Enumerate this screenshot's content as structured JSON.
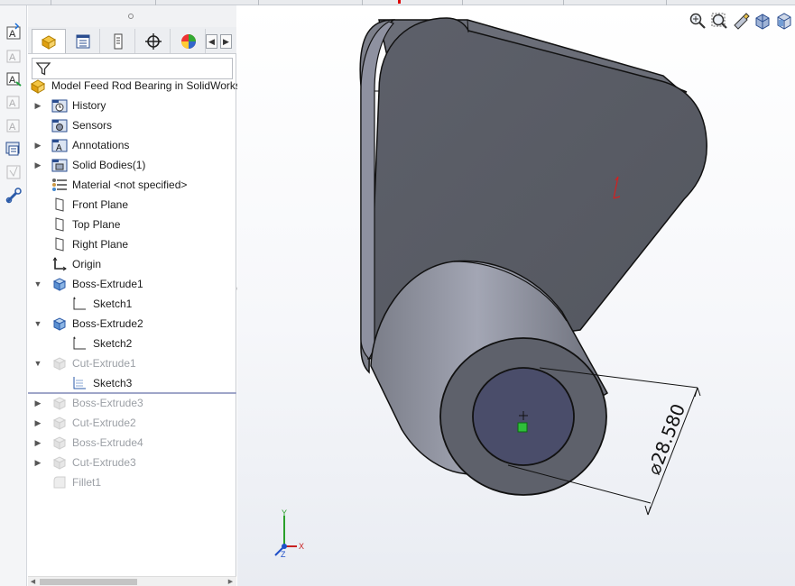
{
  "feature_manager": {
    "root_label": "Model Feed Rod Bearing in SolidWorks",
    "tabs": [
      {
        "name": "tab-featuremanager",
        "icon": "featuremanager-tree-icon"
      },
      {
        "name": "tab-propertymanager",
        "icon": "propertymanager-icon"
      },
      {
        "name": "tab-configurationmanager",
        "icon": "configurationmanager-icon"
      },
      {
        "name": "tab-dimxpertmanager",
        "icon": "dimxpert-crosshair-icon"
      },
      {
        "name": "tab-displaymanager",
        "icon": "displaymanager-pie-icon"
      }
    ],
    "filter_icon": "filter-funnel-icon",
    "items": [
      {
        "label": "History",
        "icon": "history-icon",
        "expandable": true,
        "suppressed": false
      },
      {
        "label": "Sensors",
        "icon": "sensors-icon",
        "expandable": false,
        "suppressed": false
      },
      {
        "label": "Annotations",
        "icon": "annotations-icon",
        "expandable": true,
        "suppressed": false
      },
      {
        "label": "Solid Bodies(1)",
        "icon": "solid-bodies-icon",
        "expandable": true,
        "suppressed": false
      },
      {
        "label": "Material <not specified>",
        "icon": "material-icon",
        "expandable": false,
        "suppressed": false
      },
      {
        "label": "Front Plane",
        "icon": "plane-icon",
        "expandable": false,
        "suppressed": false
      },
      {
        "label": "Top Plane",
        "icon": "plane-icon",
        "expandable": false,
        "suppressed": false
      },
      {
        "label": "Right Plane",
        "icon": "plane-icon",
        "expandable": false,
        "suppressed": false
      },
      {
        "label": "Origin",
        "icon": "origin-icon",
        "expandable": false,
        "suppressed": false
      },
      {
        "label": "Boss-Extrude1",
        "icon": "boss-extrude-icon",
        "expandable": true,
        "expanded": true,
        "suppressed": false
      },
      {
        "label": "Sketch1",
        "icon": "sketch-icon",
        "child": true,
        "suppressed": false
      },
      {
        "label": "Boss-Extrude2",
        "icon": "boss-extrude-icon",
        "expandable": true,
        "expanded": true,
        "suppressed": false
      },
      {
        "label": "Sketch2",
        "icon": "sketch-icon",
        "child": true,
        "suppressed": false
      },
      {
        "label": "Cut-Extrude1",
        "icon": "cut-extrude-icon",
        "expandable": true,
        "expanded": true,
        "suppressed": true
      },
      {
        "label": "Sketch3",
        "icon": "sketch-icon",
        "child": true,
        "suppressed": false,
        "selected_sketch": true
      },
      {
        "label": "Boss-Extrude3",
        "icon": "boss-extrude-icon",
        "expandable": true,
        "suppressed": true
      },
      {
        "label": "Cut-Extrude2",
        "icon": "cut-extrude-icon",
        "expandable": true,
        "suppressed": true
      },
      {
        "label": "Boss-Extrude4",
        "icon": "boss-extrude-icon",
        "expandable": true,
        "suppressed": true
      },
      {
        "label": "Cut-Extrude3",
        "icon": "cut-extrude-icon",
        "expandable": true,
        "suppressed": true
      },
      {
        "label": "Fillet1",
        "icon": "fillet-icon",
        "expandable": false,
        "suppressed": true
      }
    ]
  },
  "command_toolbar": [
    {
      "icon": "smart-dimension-icon",
      "enabled": true
    },
    {
      "icon": "note-icon",
      "enabled": false
    },
    {
      "icon": "auto-balloon-icon",
      "enabled": true
    },
    {
      "icon": "linked-note-icon",
      "enabled": false
    },
    {
      "icon": "balloon-icon",
      "enabled": false
    },
    {
      "icon": "model-items-icon",
      "enabled": true
    },
    {
      "icon": "surface-finish-icon",
      "enabled": false
    },
    {
      "icon": "weld-symbol-icon",
      "enabled": true
    }
  ],
  "heads_up_toolbar": [
    {
      "icon": "zoom-to-fit-icon"
    },
    {
      "icon": "zoom-to-area-icon"
    },
    {
      "icon": "previous-view-icon"
    },
    {
      "icon": "section-view-icon"
    },
    {
      "icon": "view-orientation-icon"
    }
  ],
  "viewport": {
    "dimension_text": "28.580",
    "diameter_symbol": "⌀",
    "triad_labels": {
      "x": "X",
      "y": "Y",
      "z": "Z"
    }
  },
  "colors": {
    "model_face": "#5c5f69",
    "model_light_face": "#9a9dab",
    "hole_face": "#4a4d6a",
    "selection_green": "#2fbf3a",
    "rollback_bar": "#9fa6c9"
  }
}
